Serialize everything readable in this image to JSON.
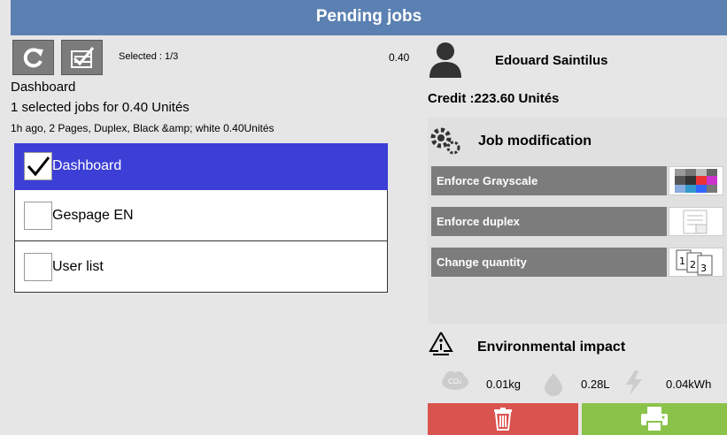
{
  "header": {
    "title": "Pending jobs"
  },
  "toolbar": {
    "selected_text": "Selected : 1/3",
    "selected_total": "0.40"
  },
  "job": {
    "title": "Dashboard",
    "summary": "1 selected jobs for 0.40 Unités",
    "details": "1h ago,  2 Pages,  Duplex,  Black &amp; white  0.40Unités"
  },
  "list": {
    "items": [
      {
        "label": "Dashboard",
        "checked": true
      },
      {
        "label": "Gespage EN",
        "checked": false
      },
      {
        "label": "User list",
        "checked": false
      }
    ]
  },
  "user": {
    "name": "Edouard Saintilus",
    "credit": "Credit :223.60 Unités"
  },
  "modification": {
    "title": "Job modification",
    "buttons": [
      {
        "label": "Enforce Grayscale",
        "icon": "grayscale-icon"
      },
      {
        "label": "Enforce duplex",
        "icon": "duplex-icon"
      },
      {
        "label": "Change quantity",
        "icon": "quantity-icon"
      }
    ]
  },
  "environment": {
    "title": "Environmental impact",
    "co2": "0.01kg",
    "water": "0.28L",
    "energy": "0.04kWh"
  },
  "colors": {
    "title_bar": "#5b80b2",
    "selected_row": "#3c3fd6",
    "delete": "#d9534f",
    "print": "#8bc34a",
    "button_gray": "#7c7c7c"
  }
}
